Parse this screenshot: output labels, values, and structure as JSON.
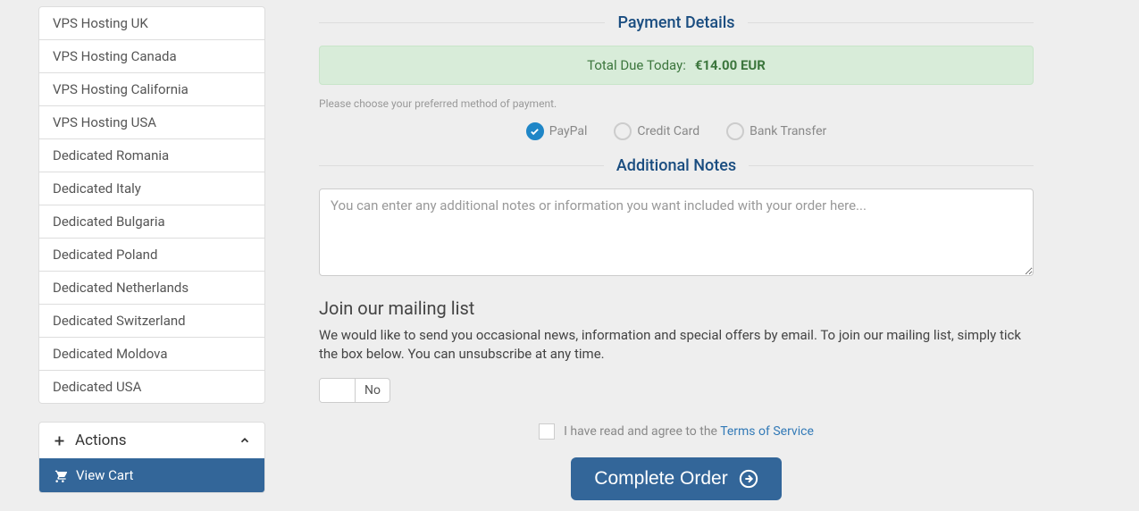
{
  "sidebar": {
    "items": [
      {
        "label": "VPS Hosting UK"
      },
      {
        "label": "VPS Hosting Canada"
      },
      {
        "label": "VPS Hosting California"
      },
      {
        "label": "VPS Hosting USA"
      },
      {
        "label": "Dedicated Romania"
      },
      {
        "label": "Dedicated Italy"
      },
      {
        "label": "Dedicated Bulgaria"
      },
      {
        "label": "Dedicated Poland"
      },
      {
        "label": "Dedicated Netherlands"
      },
      {
        "label": "Dedicated Switzerland"
      },
      {
        "label": "Dedicated Moldova"
      },
      {
        "label": "Dedicated USA"
      }
    ],
    "actions_title": "Actions",
    "view_cart_label": "View Cart"
  },
  "payment": {
    "heading": "Payment Details",
    "total_due_label": "Total Due Today:",
    "total_due_amount": "€14.00 EUR",
    "choose_text": "Please choose your preferred method of payment.",
    "options": [
      {
        "label": "PayPal",
        "selected": true
      },
      {
        "label": "Credit Card",
        "selected": false
      },
      {
        "label": "Bank Transfer",
        "selected": false
      }
    ]
  },
  "notes": {
    "heading": "Additional Notes",
    "placeholder": "You can enter any additional notes or information you want included with your order here..."
  },
  "mailing": {
    "heading": "Join our mailing list",
    "text": "We would like to send you occasional news, information and special offers by email. To join our mailing list, simply tick the box below. You can unsubscribe at any time.",
    "toggle_state": "No"
  },
  "tos": {
    "text_prefix": "I have read and agree to the ",
    "link_text": "Terms of Service"
  },
  "complete_button": "Complete Order"
}
